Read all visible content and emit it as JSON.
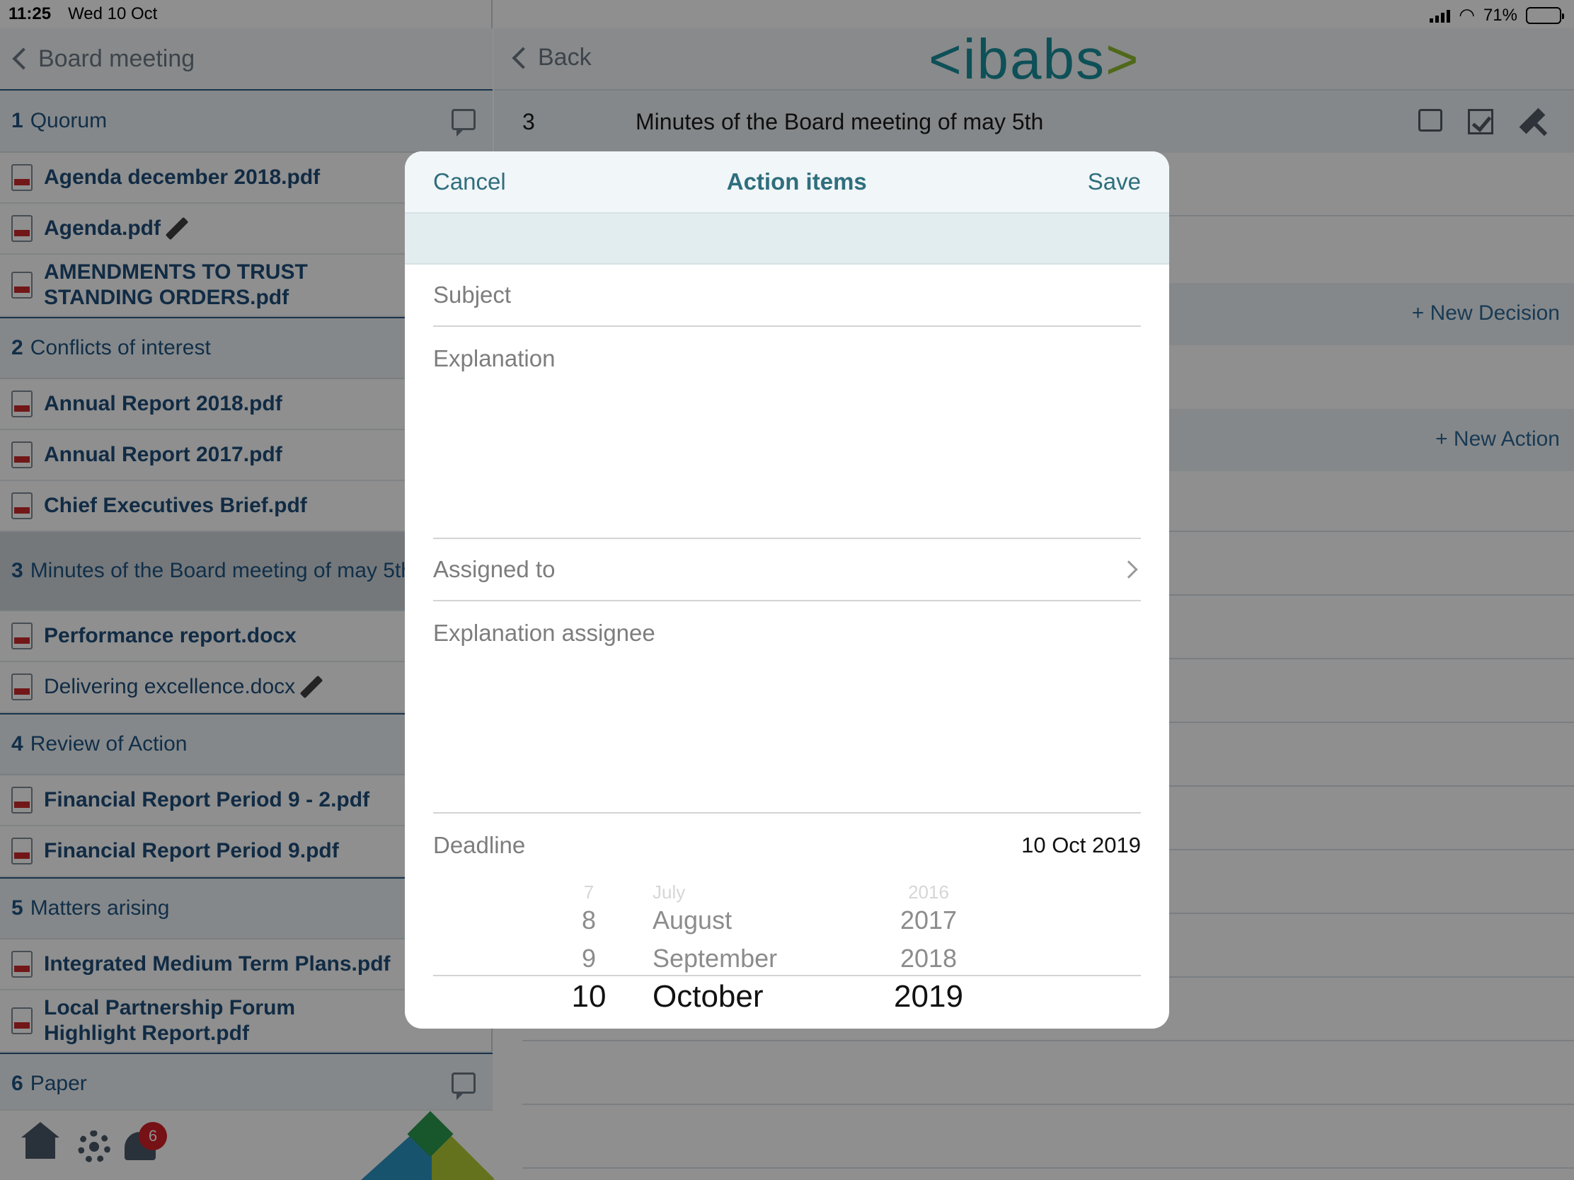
{
  "status": {
    "time": "11:25",
    "date": "Wed 10 Oct",
    "battery": "71%",
    "battery_level": 0.71
  },
  "left": {
    "back_label": "Board meeting",
    "sections": [
      {
        "num": "1",
        "title": "Quorum",
        "files": [
          {
            "name": "Agenda december 2018.pdf"
          },
          {
            "name": "Agenda.pdf"
          },
          {
            "name": "AMENDMENTS TO TRUST STANDING ORDERS.pdf"
          }
        ]
      },
      {
        "num": "2",
        "title": "Conflicts of interest",
        "files": [
          {
            "name": "Annual Report 2018.pdf"
          },
          {
            "name": "Annual Report 2017.pdf"
          },
          {
            "name": "Chief Executives Brief.pdf"
          }
        ]
      },
      {
        "num": "3",
        "title": "Minutes of the Board meeting of may 5th",
        "files": [
          {
            "name": "Performance report.docx"
          },
          {
            "name": "Delivering excellence.docx"
          }
        ]
      },
      {
        "num": "4",
        "title": "Review of Action",
        "files": [
          {
            "name": "Financial Report Period 9 - 2.pdf"
          },
          {
            "name": "Financial Report Period 9.pdf"
          }
        ]
      },
      {
        "num": "5",
        "title": "Matters arising",
        "files": [
          {
            "name": "Integrated Medium Term Plans.pdf"
          },
          {
            "name": "Local Partnership Forum Highlight Report.pdf"
          }
        ]
      },
      {
        "num": "6",
        "title": "Paper",
        "files": []
      }
    ],
    "notification_count": "6"
  },
  "right": {
    "back_label": "Back",
    "logo": {
      "left": "<",
      "main": "ibabs",
      "right": ">"
    },
    "item_num": "3",
    "item_title": "Minutes of the Board meeting of may 5th",
    "new_decision": "+ New Decision",
    "new_action": "+ New Action"
  },
  "modal": {
    "cancel": "Cancel",
    "title": "Action items",
    "save": "Save",
    "subject_label": "Subject",
    "explanation_label": "Explanation",
    "assigned_label": "Assigned to",
    "explanation_assignee_label": "Explanation assignee",
    "deadline_label": "Deadline",
    "deadline_value": "10 Oct 2019",
    "picker": {
      "days": [
        "7",
        "8",
        "9",
        "10"
      ],
      "months": [
        "July",
        "August",
        "September",
        "October"
      ],
      "years": [
        "2016",
        "2017",
        "2018",
        "2019"
      ]
    }
  },
  "colors": {
    "accent": "#2f6e7d",
    "nav_blue": "#1f5583",
    "logo_teal": "#1a8f9c",
    "logo_green": "#8dbb2e",
    "badge_red": "#d21f26"
  }
}
